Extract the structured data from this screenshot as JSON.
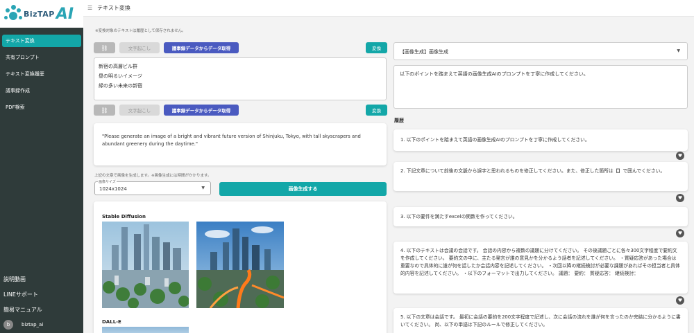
{
  "sidebar": {
    "logo_text": "BizTAP",
    "logo_ai": "AI",
    "items": [
      {
        "label": "テキスト変換",
        "active": true
      },
      {
        "label": "共有プロンプト"
      },
      {
        "label": "テキスト変換履歴"
      },
      {
        "label": "議事録作成"
      },
      {
        "label": "PDF検索"
      }
    ],
    "bottom": [
      {
        "label": "説明動画"
      },
      {
        "label": "LINEサポート"
      },
      {
        "label": "簡易マニュアル"
      }
    ],
    "user": {
      "initial": "b",
      "name": "biztap_ai"
    }
  },
  "header": {
    "title": "テキスト変換"
  },
  "left": {
    "note": "※変換対象のテキストは履歴として保存されません。",
    "link_btn": "⛓",
    "mic_btn": "文字起こし",
    "fetch_btn": "議事録データからデータ取得",
    "convert_btn": "変換",
    "input_lines": [
      "新宿の高層ビル群",
      "昼の明るいイメージ",
      "緑の多い未来の新宿"
    ],
    "result_text": "\"Please generate an image of a bright and vibrant future version of Shinjuku, Tokyo, with tall skyscrapers and abundant greenery during the daytime.\"",
    "hint": "上記の文章で画像を生成します。※画像生成には時間がかかります。",
    "size_label": "画像サイズ",
    "size_value": "1024x1024",
    "generate_btn": "画像生成する",
    "sections": {
      "sd": "Stable Diffusion",
      "dalle": "DALL-E"
    }
  },
  "right": {
    "prompt_select": "【画像生成】画像生成",
    "prompt_text": "以下のポイントを踏まえて英語の画像生成AIのプロンプトを丁寧に作成してください。",
    "history_title": "履歴",
    "history": [
      {
        "text": "1. 以下のポイントを踏まえて英語の画像生成AIのプロンプトを丁寧に作成してください。"
      },
      {
        "text": "2. 下記文章について前後の文脈から誤字と思われるものを修正してください。また、修正した箇所は【】で囲んでください。"
      },
      {
        "text": "3. 以下の要件を満たすexcelの関数を作ってください。"
      },
      {
        "text": "4. 以下のテキストは会議の会話です。 会話の内容から複数の議題に分けてください。 その後議題ごとに各々300文字程度で要約文を作成してください。 要約文の中に、主たる発言が誰の意見かを分かるよう話者を記述してください。 ・質疑応答があった場合は重要なので具体的に誰が何を話したか会話内容を記述してください。 ・次回以降の継続検討が必要な課題があればその担当者と具体的内容を記述してください。 ・以下のフォーマットで出力してください。 議題： 要約： 質疑応答： 継続検討："
      },
      {
        "text": "5. 以下の文章は会話です。 最初に会話の要約を200文字程度で記述し、次に会話の流れを誰が何を言ったのか完結に分かるように書いてください。 尚、以下の単語は下記のルールで修正してください。"
      }
    ]
  },
  "colors": {
    "accent": "#13a7a8",
    "sidebar": "#2f3b3a",
    "fetch": "#4a5ac0"
  }
}
